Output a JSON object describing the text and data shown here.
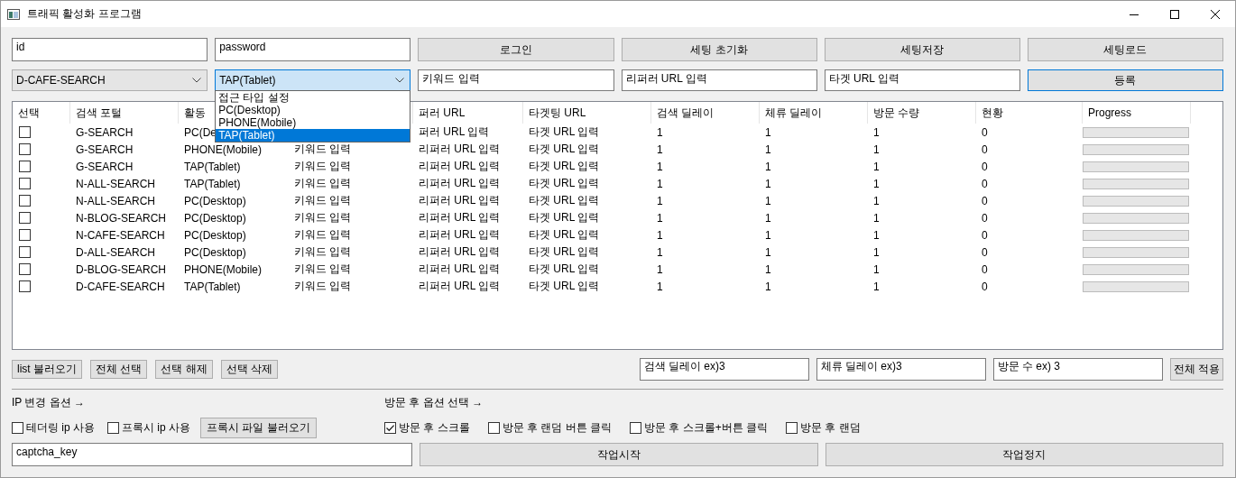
{
  "window": {
    "title": "트래픽 활성화 프로그램"
  },
  "login": {
    "id": "id",
    "password": "password",
    "buttons": [
      "로그인",
      "세팅 초기화",
      "세팅저장",
      "세팅로드"
    ]
  },
  "entry": {
    "portal": "D-CAFE-SEARCH",
    "access_type": {
      "value": "TAP(Tablet)",
      "expanded": true,
      "options": [
        {
          "label": "접근 타입 설정",
          "selected": false
        },
        {
          "label": "PC(Desktop)",
          "selected": false
        },
        {
          "label": "PHONE(Mobile)",
          "selected": false
        },
        {
          "label": "TAP(Tablet)",
          "selected": true
        }
      ]
    },
    "keyword": "키워드 입력",
    "referrer": "리퍼러 URL 입력",
    "target": "타겟 URL 입력",
    "register_button": "등록"
  },
  "table": {
    "columns": [
      "선택",
      "검색 포털",
      "활동",
      "퍼러 URL",
      "타겟팅 URL",
      "검색 딜레이",
      "체류 딜레이",
      "방문 수량",
      "현황",
      "Progress"
    ],
    "rows": [
      {
        "checked": false,
        "portal": "G-SEARCH",
        "activity": "PC(De",
        "referrer": "퍼러 URL 입력",
        "target": "타겟 URL 입력",
        "search_delay": "1",
        "stay_delay": "1",
        "visits": "1",
        "status": "0",
        "level": 0
      },
      {
        "checked": false,
        "portal": "G-SEARCH",
        "activity": "PHONE(Mobile)",
        "keyword": "키워드 입력",
        "referrer": "리퍼러 URL 입력",
        "target": "타겟 URL 입력",
        "search_delay": "1",
        "stay_delay": "1",
        "visits": "1",
        "status": "0",
        "level": 0
      },
      {
        "checked": false,
        "portal": "G-SEARCH",
        "activity": "TAP(Tablet)",
        "keyword": "키워드 입력",
        "referrer": "리퍼러 URL 입력",
        "target": "타겟 URL 입력",
        "search_delay": "1",
        "stay_delay": "1",
        "visits": "1",
        "status": "0",
        "level": 0
      },
      {
        "checked": false,
        "portal": "N-ALL-SEARCH",
        "activity": "TAP(Tablet)",
        "keyword": "키워드 입력",
        "referrer": "리퍼러 URL 입력",
        "target": "타겟 URL 입력",
        "search_delay": "1",
        "stay_delay": "1",
        "visits": "1",
        "status": "0",
        "level": 0
      },
      {
        "checked": false,
        "portal": "N-ALL-SEARCH",
        "activity": "PC(Desktop)",
        "keyword": "키워드 입력",
        "referrer": "리퍼러 URL 입력",
        "target": "타겟 URL 입력",
        "search_delay": "1",
        "stay_delay": "1",
        "visits": "1",
        "status": "0",
        "level": 0
      },
      {
        "checked": false,
        "portal": "N-BLOG-SEARCH",
        "activity": "PC(Desktop)",
        "keyword": "키워드 입력",
        "referrer": "리퍼러 URL 입력",
        "target": "타겟 URL 입력",
        "search_delay": "1",
        "stay_delay": "1",
        "visits": "1",
        "status": "0",
        "level": 0
      },
      {
        "checked": false,
        "portal": "N-CAFE-SEARCH",
        "activity": "PC(Desktop)",
        "keyword": "키워드 입력",
        "referrer": "리퍼러 URL 입력",
        "target": "타겟 URL 입력",
        "search_delay": "1",
        "stay_delay": "1",
        "visits": "1",
        "status": "0",
        "level": 0
      },
      {
        "checked": false,
        "portal": "D-ALL-SEARCH",
        "activity": "PC(Desktop)",
        "keyword": "키워드 입력",
        "referrer": "리퍼러 URL 입력",
        "target": "타겟 URL 입력",
        "search_delay": "1",
        "stay_delay": "1",
        "visits": "1",
        "status": "0",
        "level": 0
      },
      {
        "checked": false,
        "portal": "D-BLOG-SEARCH",
        "activity": "PHONE(Mobile)",
        "keyword": "키워드 입력",
        "referrer": "리퍼러 URL 입력",
        "target": "타겟 URL 입력",
        "search_delay": "1",
        "stay_delay": "1",
        "visits": "1",
        "status": "0",
        "level": 0
      },
      {
        "checked": false,
        "portal": "D-CAFE-SEARCH",
        "activity": "TAP(Tablet)",
        "keyword": "키워드 입력",
        "referrer": "리퍼러 URL 입력",
        "target": "타겟 URL 입력",
        "search_delay": "1",
        "stay_delay": "1",
        "visits": "1",
        "status": "0",
        "level": 0
      }
    ]
  },
  "list_buttons": [
    "list 불러오기",
    "전체 선택",
    "선택 해제",
    "선택 삭제"
  ],
  "bulk": {
    "search_delay": "검색 딜레이 ex)3",
    "stay_delay": "체류 딜레이 ex)3",
    "visits": "방문 수 ex) 3",
    "apply_button": "전체 적용"
  },
  "ip_options": {
    "label": "IP 변경 옵션 →",
    "checks": [
      {
        "label": "테더링 ip 사용",
        "checked": false
      },
      {
        "label": "프록시 ip 사용",
        "checked": false
      }
    ],
    "file_button": "프록시 파일 불러오기"
  },
  "visit_options": {
    "label": "방문 후 옵션 선택 →",
    "checks": [
      {
        "label": "방문 후 스크롤",
        "checked": true
      },
      {
        "label": "방문 후 랜덤 버튼 클릭",
        "checked": false
      },
      {
        "label": "방문 후 스크롤+버튼 클릭",
        "checked": false
      },
      {
        "label": "방문 후 랜덤",
        "checked": false
      }
    ]
  },
  "captcha_key": "captcha_key",
  "start_button": "작업시작",
  "stop_button": "작업정지"
}
